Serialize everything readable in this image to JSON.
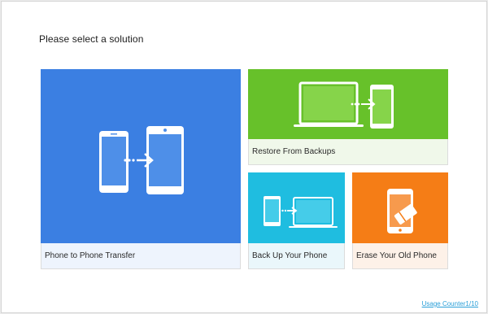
{
  "title": "Please select a solution",
  "solutions": {
    "phone_transfer": {
      "label": "Phone to Phone Transfer",
      "color": "#3b7fe2",
      "icon": "phone-to-phone-icon"
    },
    "restore": {
      "label": "Restore From Backups",
      "color": "#67c12a",
      "icon": "laptop-to-phone-icon"
    },
    "backup": {
      "label": "Back Up Your Phone",
      "color": "#1fbde0",
      "icon": "phone-to-laptop-icon"
    },
    "erase": {
      "label": "Erase Your Old Phone",
      "color": "#f57d16",
      "icon": "phone-eraser-icon"
    }
  },
  "footer": {
    "usage_counter": "Usage Counter1/10"
  }
}
